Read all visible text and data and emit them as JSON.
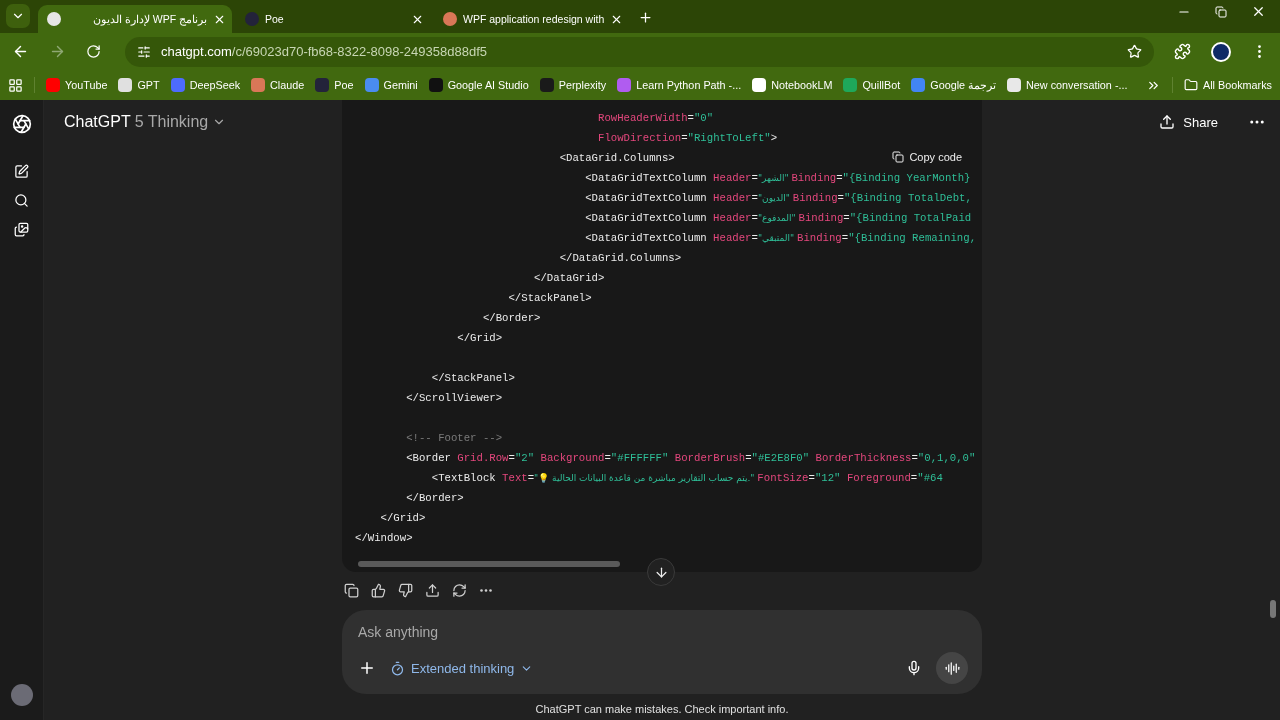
{
  "browser": {
    "tabs": [
      {
        "title": "برنامج WPF لإدارة الديون",
        "selected": true,
        "color": "#e6e6e6"
      },
      {
        "title": "Poe",
        "selected": false,
        "color": "#23233a"
      },
      {
        "title": "WPF application redesign with",
        "selected": false,
        "color": "#d97757"
      }
    ],
    "url": {
      "host": "chatgpt.com",
      "path": "/c/69023d70-fb68-8322-8098-249358d88df5"
    },
    "bookmarks": [
      {
        "label": "YouTube",
        "color": "#ff0000"
      },
      {
        "label": "GPT",
        "color": "#e0e0e0"
      },
      {
        "label": "DeepSeek",
        "color": "#4d6bfe"
      },
      {
        "label": "Claude",
        "color": "#d97757"
      },
      {
        "label": "Poe",
        "color": "#23233a"
      },
      {
        "label": "Gemini",
        "color": "#4a8cf0"
      },
      {
        "label": "Google AI Studio",
        "color": "#111111"
      },
      {
        "label": "Perplexity",
        "color": "#1a1a1a"
      },
      {
        "label": "Learn Python Path -...",
        "color": "#b05cf0"
      },
      {
        "label": "NotebookLM",
        "color": "#ffffff"
      },
      {
        "label": "QuillBot",
        "color": "#1fa85a"
      },
      {
        "label": "Google ترجمة",
        "color": "#4285f4"
      },
      {
        "label": "New conversation -...",
        "color": "#e8e8e8"
      }
    ],
    "all_bookmarks": "All Bookmarks"
  },
  "chat": {
    "model": {
      "name": "ChatGPT",
      "variant": "5 Thinking"
    },
    "share": "Share",
    "code": {
      "copy_label": "Copy code",
      "lines": [
        {
          "kind": "code",
          "tokens": [
            {
              "kind": "attr",
              "text": "                                      RowHeaderWidth"
            },
            {
              "kind": "punct",
              "text": "="
            },
            {
              "kind": "value",
              "text": "\"0\""
            }
          ]
        },
        {
          "kind": "code",
          "tokens": [
            {
              "kind": "attr",
              "text": "                                      FlowDirection"
            },
            {
              "kind": "punct",
              "text": "="
            },
            {
              "kind": "value",
              "text": "\"RightToLeft\""
            },
            {
              "kind": "punct",
              "text": ">"
            }
          ]
        },
        {
          "kind": "code",
          "tokens": [
            {
              "kind": "tag",
              "text": "                                <DataGrid.Columns>"
            }
          ]
        },
        {
          "kind": "code",
          "tokens": [
            {
              "kind": "tag",
              "text": "                                    <DataGridTextColumn "
            },
            {
              "kind": "attr",
              "text": "Header"
            },
            {
              "kind": "punct",
              "text": "="
            },
            {
              "kind": "value",
              "text": "\"الشهر\" "
            },
            {
              "kind": "attr",
              "text": "Binding"
            },
            {
              "kind": "punct",
              "text": "="
            },
            {
              "kind": "value",
              "text": "\"{Binding YearMonth}"
            }
          ]
        },
        {
          "kind": "code",
          "tokens": [
            {
              "kind": "tag",
              "text": "                                    <DataGridTextColumn "
            },
            {
              "kind": "attr",
              "text": "Header"
            },
            {
              "kind": "punct",
              "text": "="
            },
            {
              "kind": "value",
              "text": "\"الديون\" "
            },
            {
              "kind": "attr",
              "text": "Binding"
            },
            {
              "kind": "punct",
              "text": "="
            },
            {
              "kind": "value",
              "text": "\"{Binding TotalDebt,"
            }
          ]
        },
        {
          "kind": "code",
          "tokens": [
            {
              "kind": "tag",
              "text": "                                    <DataGridTextColumn "
            },
            {
              "kind": "attr",
              "text": "Header"
            },
            {
              "kind": "punct",
              "text": "="
            },
            {
              "kind": "value",
              "text": "\"المدفوع\" "
            },
            {
              "kind": "attr",
              "text": "Binding"
            },
            {
              "kind": "punct",
              "text": "="
            },
            {
              "kind": "value",
              "text": "\"{Binding TotalPaid"
            }
          ]
        },
        {
          "kind": "code",
          "tokens": [
            {
              "kind": "tag",
              "text": "                                    <DataGridTextColumn "
            },
            {
              "kind": "attr",
              "text": "Header"
            },
            {
              "kind": "punct",
              "text": "="
            },
            {
              "kind": "value",
              "text": "\"المتبقي\" "
            },
            {
              "kind": "attr",
              "text": "Binding"
            },
            {
              "kind": "punct",
              "text": "="
            },
            {
              "kind": "value",
              "text": "\"{Binding Remaining,"
            }
          ]
        },
        {
          "kind": "code",
          "tokens": [
            {
              "kind": "tag",
              "text": "                                </DataGrid.Columns>"
            }
          ]
        },
        {
          "kind": "code",
          "tokens": [
            {
              "kind": "tag",
              "text": "                            </DataGrid>"
            }
          ]
        },
        {
          "kind": "code",
          "tokens": [
            {
              "kind": "tag",
              "text": "                        </StackPanel>"
            }
          ]
        },
        {
          "kind": "code",
          "tokens": [
            {
              "kind": "tag",
              "text": "                    </Border>"
            }
          ]
        },
        {
          "kind": "code",
          "tokens": [
            {
              "kind": "tag",
              "text": "                </Grid>"
            }
          ]
        },
        {
          "kind": "blank"
        },
        {
          "kind": "code",
          "tokens": [
            {
              "kind": "tag",
              "text": "            </StackPanel>"
            }
          ]
        },
        {
          "kind": "code",
          "tokens": [
            {
              "kind": "tag",
              "text": "        </ScrollViewer>"
            }
          ]
        },
        {
          "kind": "blank"
        },
        {
          "kind": "code",
          "tokens": [
            {
              "kind": "comment",
              "text": "        <!-- Footer -->"
            }
          ]
        },
        {
          "kind": "code",
          "tokens": [
            {
              "kind": "tag",
              "text": "        <Border "
            },
            {
              "kind": "attr",
              "text": "Grid.Row"
            },
            {
              "kind": "punct",
              "text": "="
            },
            {
              "kind": "value",
              "text": "\"2\" "
            },
            {
              "kind": "attr",
              "text": "Background"
            },
            {
              "kind": "punct",
              "text": "="
            },
            {
              "kind": "value",
              "text": "\"#FFFFFF\" "
            },
            {
              "kind": "attr",
              "text": "BorderBrush"
            },
            {
              "kind": "punct",
              "text": "="
            },
            {
              "kind": "value",
              "text": "\"#E2E8F0\" "
            },
            {
              "kind": "attr",
              "text": "BorderThickness"
            },
            {
              "kind": "punct",
              "text": "="
            },
            {
              "kind": "value",
              "text": "\"0,1,0,0\""
            }
          ]
        },
        {
          "kind": "code",
          "tokens": [
            {
              "kind": "tag",
              "text": "            <TextBlock "
            },
            {
              "kind": "attr",
              "text": "Text"
            },
            {
              "kind": "punct",
              "text": "="
            },
            {
              "kind": "value",
              "text": "\"💡 يتم حساب التقارير مباشرة من قاعدة البيانات الحالية.\" "
            },
            {
              "kind": "attr",
              "text": "FontSize"
            },
            {
              "kind": "punct",
              "text": "="
            },
            {
              "kind": "value",
              "text": "\"12\" "
            },
            {
              "kind": "attr",
              "text": "Foreground"
            },
            {
              "kind": "punct",
              "text": "="
            },
            {
              "kind": "value",
              "text": "\"#64"
            }
          ]
        },
        {
          "kind": "code",
          "tokens": [
            {
              "kind": "tag",
              "text": "        </Border>"
            }
          ]
        },
        {
          "kind": "code",
          "tokens": [
            {
              "kind": "tag",
              "text": "    </Grid>"
            }
          ]
        },
        {
          "kind": "code",
          "tokens": [
            {
              "kind": "tag",
              "text": "</Window>"
            }
          ]
        }
      ]
    },
    "composer": {
      "placeholder": "Ask anything",
      "mode": "Extended thinking"
    },
    "disclaimer": "ChatGPT can make mistakes. Check important info."
  }
}
